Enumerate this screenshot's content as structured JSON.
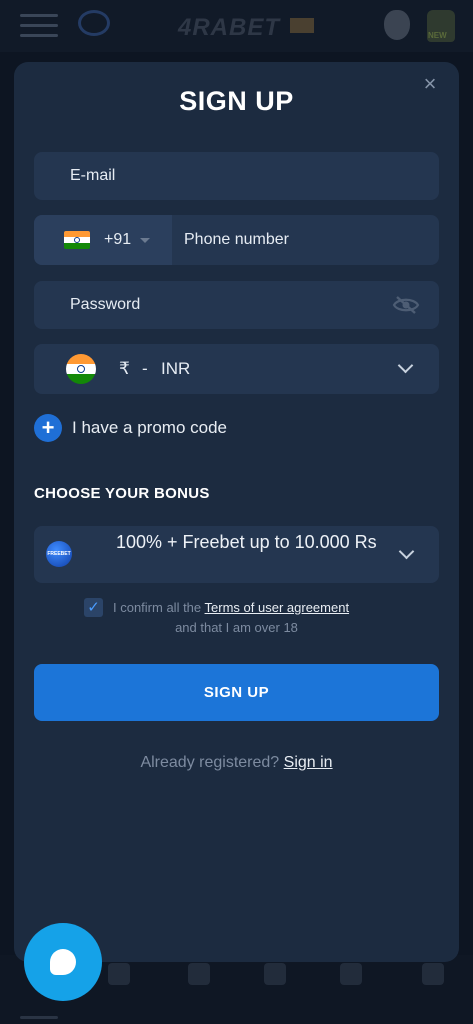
{
  "app": {
    "logo_text": "4RABET"
  },
  "modal": {
    "title": "SIGN UP",
    "close_symbol": "×"
  },
  "form": {
    "email_placeholder": "E-mail",
    "phone_code": "+91",
    "phone_placeholder": "Phone number",
    "password_placeholder": "Password",
    "currency_symbol": "₹",
    "currency_separator": "-",
    "currency_code": "INR"
  },
  "promo": {
    "label": "I have a promo code",
    "icon": "plus-icon"
  },
  "bonus": {
    "heading": "CHOOSE YOUR BONUS",
    "badge_text": "FREEBET",
    "selected_label": "100% + Freebet up to 10.000 Rs"
  },
  "agreement": {
    "checked": true,
    "prefix": "I confirm all the",
    "link": "Terms of user agreement",
    "line2": "and that I am over 18"
  },
  "submit": {
    "label": "SIGN UP"
  },
  "footer": {
    "question": "Already registered?",
    "signin_link": "Sign in"
  },
  "colors": {
    "background": "#0d1522",
    "modal": "#1c2b40",
    "field": "#243650",
    "primary": "#1c75d8",
    "chat_fab": "#15a2e8"
  }
}
